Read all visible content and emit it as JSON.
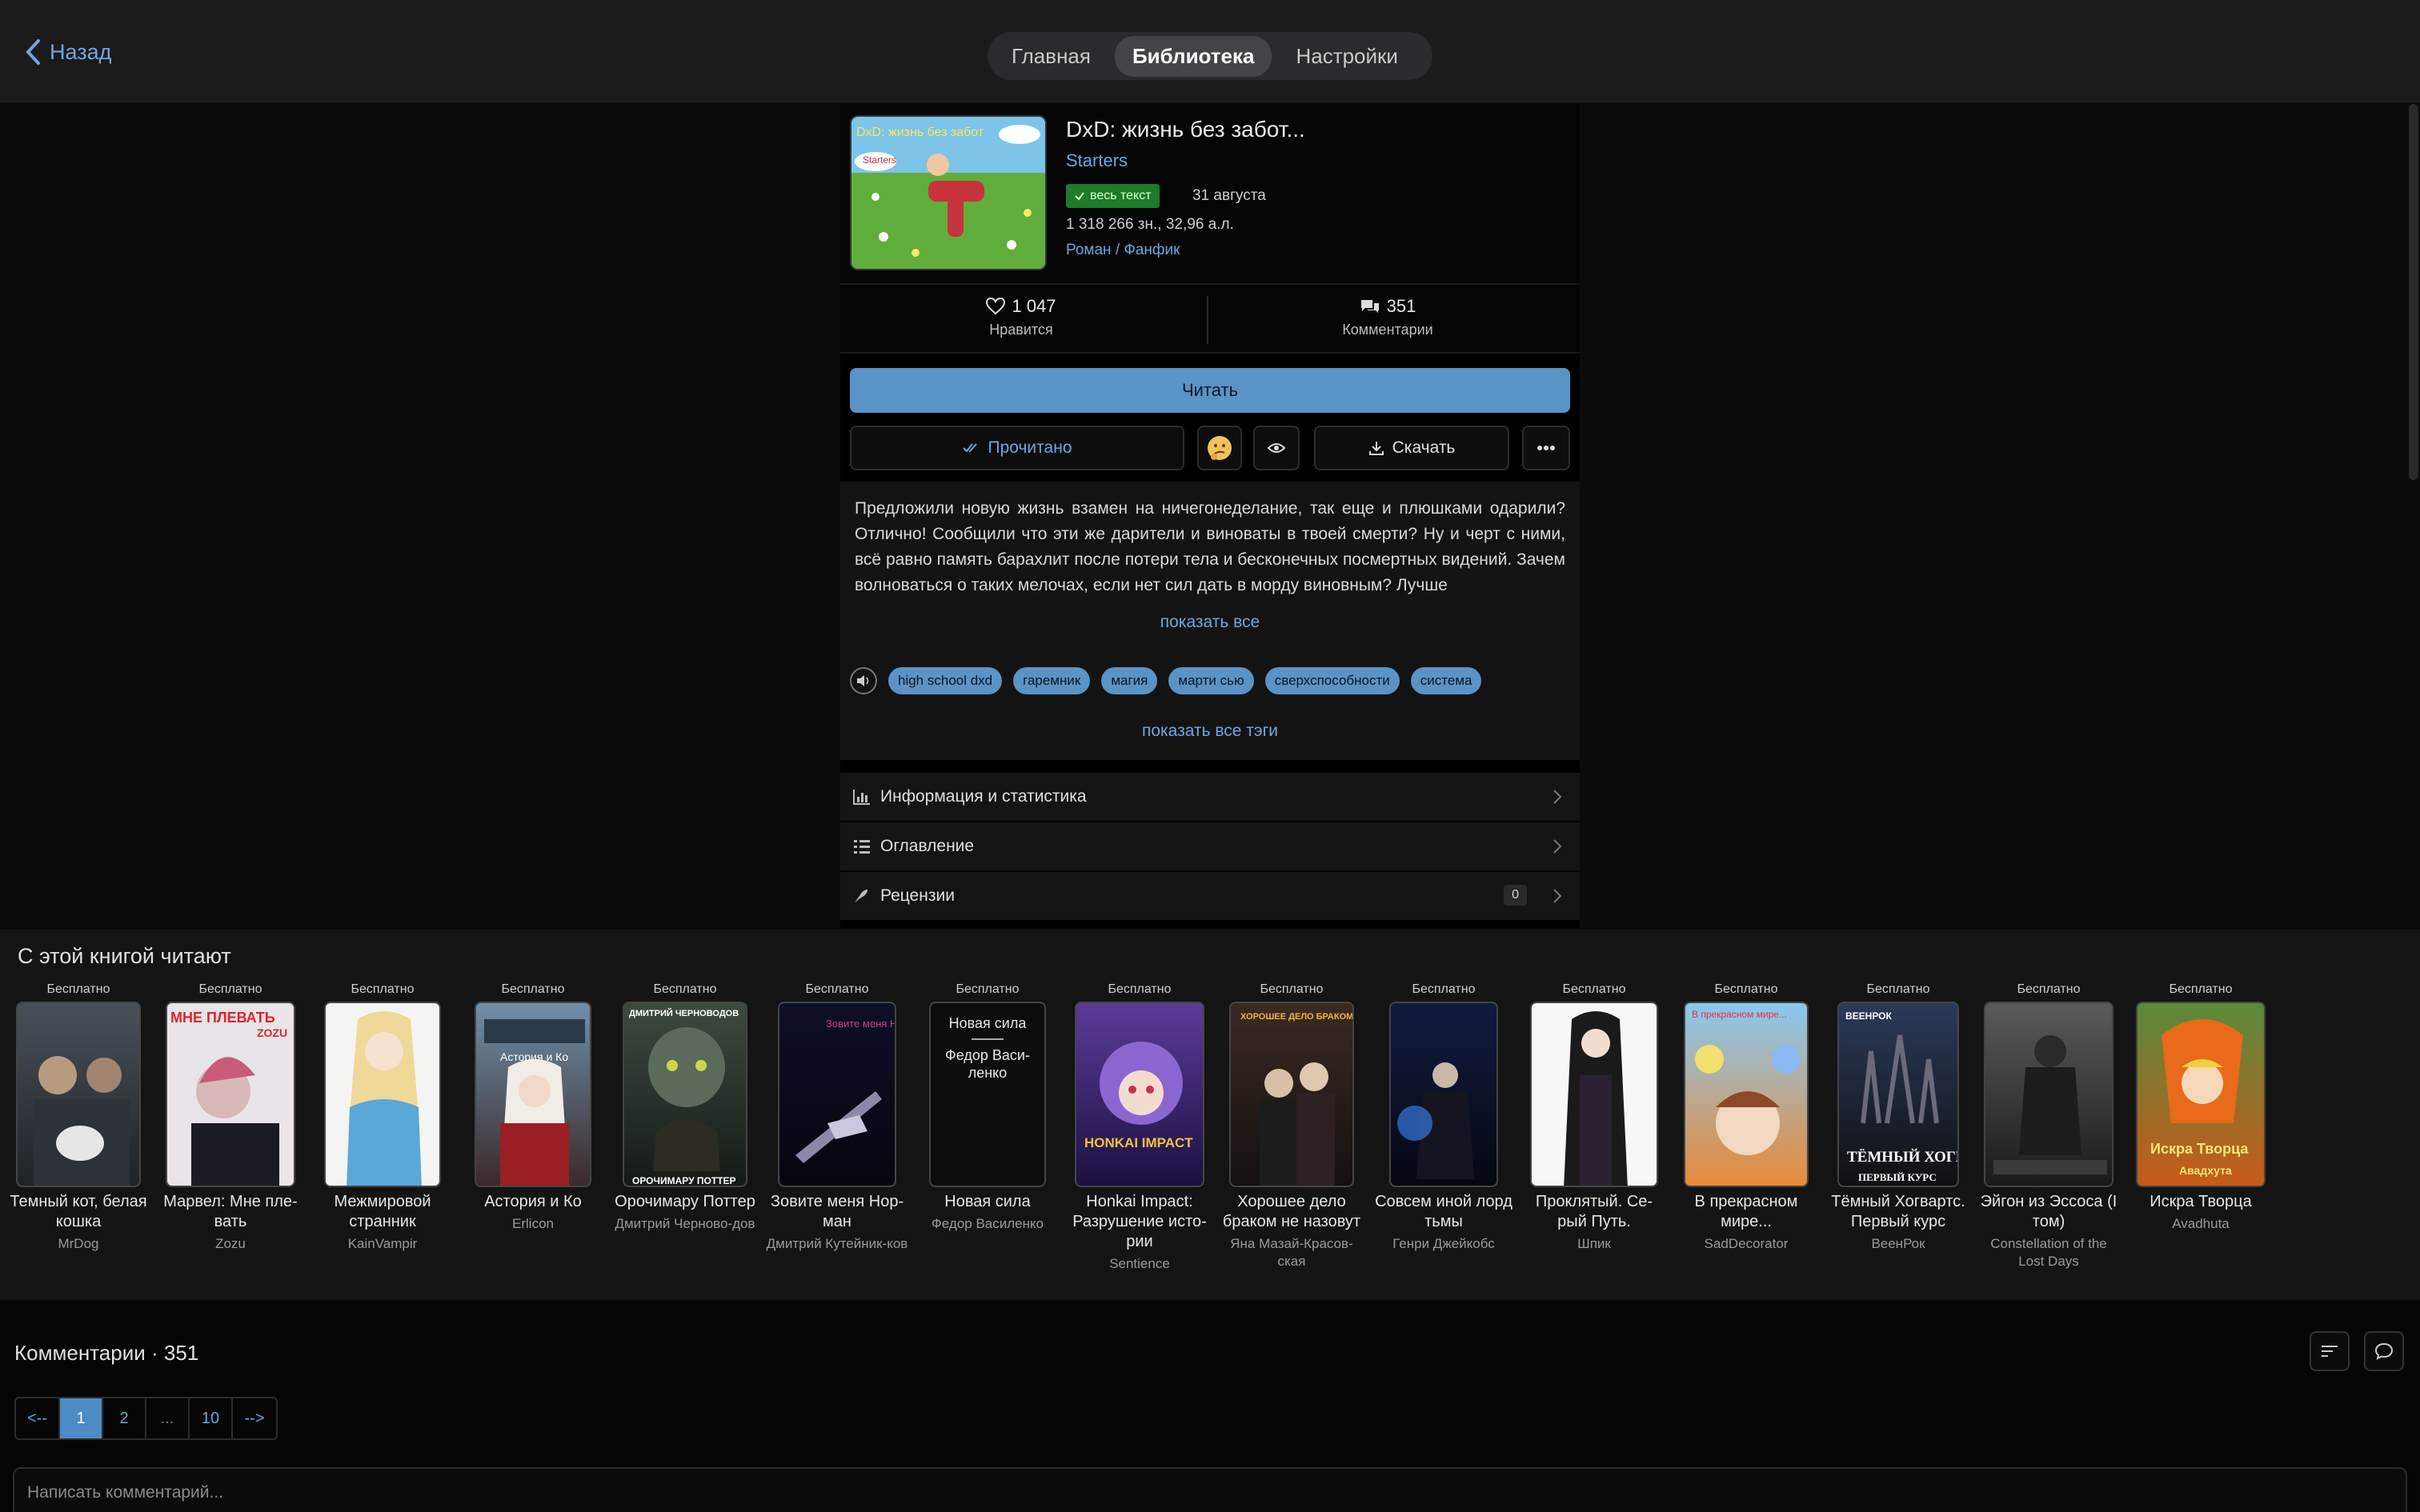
{
  "header": {
    "back_label": "Назад",
    "tabs": [
      "Главная",
      "Библиотека",
      "Настройки"
    ],
    "active_tab": "Библиотека"
  },
  "book": {
    "title": "DxD: жизнь без забот...",
    "cover_text": "DxD: жизнь без забот",
    "cover_author": "Starters",
    "author": "Starters",
    "status_badge": "весь текст",
    "date": "31 августа",
    "size": "1 318 266 зн., 32,96 а.л.",
    "genre_1": "Роман",
    "genre_sep": "/",
    "genre_2": "Фанфик",
    "likes": "1 047",
    "likes_label": "Нравится",
    "comments": "351",
    "comments_label": "Комментарии"
  },
  "actions": {
    "read": "Читать",
    "read_status": "Прочитано",
    "download": "Скачать"
  },
  "description": {
    "text": "Предложили новую жизнь взамен на ничегонеделание, так еще и плюшками одарили? Отлично! Сообщили что эти же дарители и виноваты в твоей смерти? Ну и черт с ними, всё равно память барахлит после потери тела и бесконечных посмертных видений. Зачем волноваться о таких мелочах, если нет сил дать в морду виновным? Лучше",
    "show_all": "показать все"
  },
  "tags": {
    "items": [
      "high school dxd",
      "гаремник",
      "магия",
      "марти сью",
      "сверхспособности",
      "система"
    ],
    "show_all": "показать все тэги"
  },
  "sections": {
    "info": "Информация и статистика",
    "toc": "Оглавление",
    "reviews": "Рецензии",
    "reviews_count": "0"
  },
  "recommendations": {
    "title": "С этой книгой читают",
    "items": [
      {
        "price": "Бесплатно",
        "name": "Темный кот, белая кошка",
        "author": "MrDog"
      },
      {
        "price": "Бесплатно",
        "name": "Марвел: Мне пле-вать",
        "author": "Zozu",
        "cover_text": "МНЕ ПЛЕВАТЬ",
        "cover_sub": "ZOZU"
      },
      {
        "price": "Бесплатно",
        "name": "Межмировой странник",
        "author": "KainVampir"
      },
      {
        "price": "Бесплатно",
        "name": "Астория и Ко",
        "author": "Erlicon",
        "cover_text": "Астория и Ко"
      },
      {
        "price": "Бесплатно",
        "name": "Орочимару Поттер",
        "author": "Дмитрий Черново-дов",
        "cover_text": "ДМИТРИЙ ЧЕРНОВОДОВ",
        "cover_sub": "ОРОЧИМАРУ ПОТТЕР"
      },
      {
        "price": "Бесплатно",
        "name": "Зовите меня Нор-ман",
        "author": "Дмитрий Кутейник-ков",
        "cover_text": "Зовите меня Норман"
      },
      {
        "price": "Бесплатно",
        "name": "Новая сила",
        "author": "Федор Василенко",
        "cover_text": "Новая сила",
        "cover_sub": "Федор Васи-ленко"
      },
      {
        "price": "Бесплатно",
        "name": "Honkai Impact: Разрушение исто-рии",
        "author": "Sentience",
        "cover_text": "HONKAI IMPACT"
      },
      {
        "price": "Бесплатно",
        "name": "Хорошее дело браком не назовут",
        "author": "Яна Мазай-Красов-ская",
        "cover_text": "ХОРОШЕЕ ДЕЛО БРАКОМ НЕ НАЗОВУТ"
      },
      {
        "price": "Бесплатно",
        "name": "Совсем иной лорд тьмы",
        "author": "Генри Джейкобс"
      },
      {
        "price": "Бесплатно",
        "name": "Проклятый. Се-рый Путь.",
        "author": "Шпик"
      },
      {
        "price": "Бесплатно",
        "name": "В прекрасном мире...",
        "author": "SadDecorator",
        "cover_text": "В прекрасном мире..."
      },
      {
        "price": "Бесплатно",
        "name": "Тёмный Хогвартс. Первый курс",
        "author": "ВеенРок",
        "cover_text": "ТЁМНЫЙ ХОГВАРТС",
        "cover_sub": "ПЕРВЫЙ КУРС"
      },
      {
        "price": "Бесплатно",
        "name": "Эйгон из Эссоса (I том)",
        "author": "Constellation of the Lost Days"
      },
      {
        "price": "Бесплатно",
        "name": "Искра Творца",
        "author": "Avadhuta",
        "cover_text": "Искра Творца",
        "cover_sub": "Авадхута"
      }
    ]
  },
  "comments": {
    "title": "Комментарии · 351",
    "pages": [
      "<--",
      "1",
      "2",
      "...",
      "10",
      "-->"
    ],
    "active_page": "1",
    "placeholder": "Написать комментарий..."
  },
  "colors": {
    "accent": "#5a93c6",
    "link": "#6ea6e0",
    "badge_green": "#1f7a2a",
    "background": "#0b0b0c"
  }
}
